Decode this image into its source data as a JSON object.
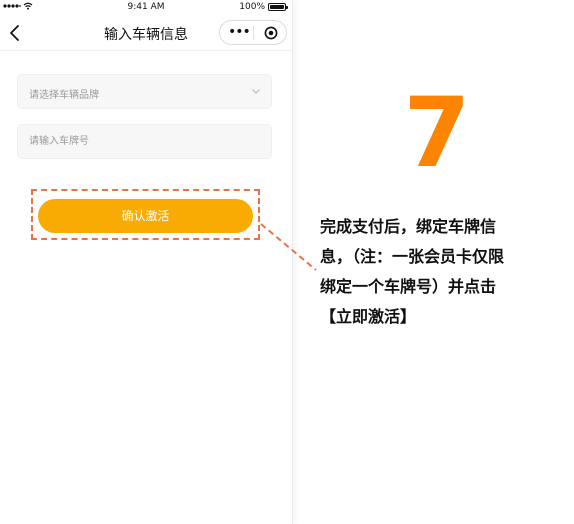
{
  "status_bar": {
    "time": "9:41 AM",
    "battery": "100%"
  },
  "nav": {
    "title": "输入车辆信息",
    "more_icon": "more-dots-icon",
    "target_icon": "target-icon"
  },
  "form": {
    "brand_placeholder": "请选择车辆品牌",
    "plate_placeholder": "请输入车牌号"
  },
  "confirm_button": "确认激活",
  "step": "7",
  "instruction": {
    "line1": "完成支付后，绑定车牌信",
    "line2": "息，（注：一张会员卡仅限",
    "line3": "绑定一个车牌号）并点击",
    "line4": "【立即激活】"
  },
  "colors": {
    "accent": "#f8ab02",
    "step": "#fc8400",
    "dash": "#e8734a"
  }
}
